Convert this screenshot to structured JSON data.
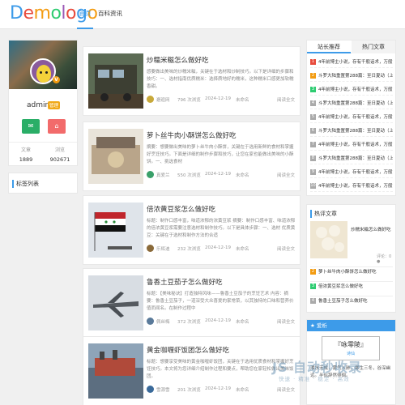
{
  "brand": {
    "logo_letters": [
      "D",
      "e",
      "m",
      "o",
      "l",
      "o",
      "g",
      "o"
    ],
    "logo_colors": [
      "#3d9be9",
      "#e84c3d",
      "#f39c12",
      "#2ecc71",
      "#9b59b6",
      "#e84c3d",
      "#3d9be9",
      "#f39c12"
    ]
  },
  "nav": {
    "home": "首页",
    "encyclopedia": "百科资讯"
  },
  "profile": {
    "name": "admin",
    "vip_label": "管理",
    "verified": "V",
    "wechat_icon": "✉",
    "weibo_icon": "⌂",
    "stats": [
      {
        "label": "文章",
        "value": "1889"
      },
      {
        "label": "浏览",
        "value": "902671"
      }
    ]
  },
  "tags_title": "标签列表",
  "posts": [
    {
      "title": "炒糯米糍怎么做好吃",
      "excerpt": "感要做出美味的炒糯米糍，关键在于选材和炒制技巧。以下是详细的步骤和技巧：一、选材指南优质糯米：选择质地好的糯米，这种糯米口感更加软糯香甜。",
      "author": "邂逅网",
      "views": "796 次浏览",
      "date": "2024-12-19",
      "category": "未命名",
      "more": "阅读全文"
    },
    {
      "title": "萝卜丝牛肉小酥饼怎么做好吃",
      "excerpt": "摘要：想要做出美味的萝卜丝牛肉小酥饼，关键在于选用新鲜的食材和掌握好烹饪技巧。下面是详细的制作步骤和技巧，让您在家也能做出美味的小酥饼。一、挑选食材",
      "author": "真爱兰",
      "views": "550 次浏览",
      "date": "2024-12-19",
      "category": "未命名",
      "more": "阅读全文"
    },
    {
      "title": "倍浓黄豆浆怎么做好吃",
      "excerpt": "标题：制作口感丰富，味道浓郁的浓黄豆浆 摘要：制作口感丰富、味道浓郁的倍浓黄豆浆需要注意选材和制作技巧。以下是具体步骤：一、选材 优质黄豆：关键在于选材和制作方法的合适",
      "author": "乐辉迪",
      "views": "232 次浏览",
      "date": "2024-12-19",
      "category": "未命名",
      "more": "阅读全文"
    },
    {
      "title": "鲁香土豆茄子怎么做好吃",
      "excerpt": "标题：【美味秘诀】打造独特风味——鲁香土豆茄子的烹饪艺术 内容：摘要：鲁香土豆茄子，一道深受大众喜爱的家常菜，以其独特的口味和营养价值而闻名。在制作过程中",
      "author": "佩丝梅",
      "views": "372 次浏览",
      "date": "2024-12-19",
      "category": "未命名",
      "more": "阅读全文"
    },
    {
      "title": "黄金咖喱虾饭团怎么做好吃",
      "excerpt": "标题：想要享受美味的黄金咖喱虾饭团，关键在于选用优质食材和掌握好烹饪技巧。本文将为您详细介绍制作过程和要点，帮助您在家轻松做出美味饭团。",
      "author": "雪源雪",
      "views": "201 次浏览",
      "date": "2024-12-19",
      "category": "未命名",
      "more": "阅读全文"
    }
  ],
  "rank": {
    "tab_active": "站长推荐",
    "tab_inactive": "热门文章",
    "items": [
      {
        "num": "1",
        "color": "#e84c3d",
        "text": "4年前博主小说，存有千般话术，万般...."
      },
      {
        "num": "2",
        "color": "#f39c12",
        "text": "斗罗大陆重置第288篇：至日夏动（上）"
      },
      {
        "num": "3",
        "color": "#2ecc71",
        "text": "4年前博主小说，存有千般话术，万般...."
      },
      {
        "num": "4",
        "color": "#aaaaaa",
        "text": "斗罗大陆重置第288篇：至日夏动（上）"
      },
      {
        "num": "5",
        "color": "#aaaaaa",
        "text": "4年前博主小说，存有千般话术，万般...."
      },
      {
        "num": "6",
        "color": "#aaaaaa",
        "text": "斗罗大陆重置第288篇：至日夏动（上）"
      },
      {
        "num": "7",
        "color": "#aaaaaa",
        "text": "4年前博主小说，存有千般话术，万般...."
      },
      {
        "num": "8",
        "color": "#aaaaaa",
        "text": "斗罗大陆重置第288篇：至日夏动（上）"
      },
      {
        "num": "9",
        "color": "#aaaaaa",
        "text": "4年前博主小说，存有千般话术，万般...."
      },
      {
        "num": "10",
        "color": "#aaaaaa",
        "text": "4年前博主小说，存有千般话术，万般...."
      }
    ]
  },
  "hot": {
    "title": "热评文章",
    "big_title": "炒糯米糍怎么做好吃",
    "big_meta": "评论：0 ●",
    "items": [
      {
        "num": "2",
        "color": "#f39c12",
        "text": "萝卜丝牛肉小酥饼怎么做好吃"
      },
      {
        "num": "3",
        "color": "#2ecc71",
        "text": "倍浓黄豆浆怎么做好吃"
      },
      {
        "num": "4",
        "color": "#aaaaaa",
        "text": "鲁香土豆茄子怎么做好吃"
      }
    ]
  },
  "fav": {
    "header": "★ 爱析",
    "card_title": "『咏零陵』",
    "card_sub": "诗仙",
    "text": "湘水无成，雾气入肺，寒生三冬，谷深幽远。半似辞然徘徊。"
  },
  "watermark": {
    "main": "JS 自动秒收录",
    "sub": "快速 · 精准 · 稳定 · 高效"
  }
}
